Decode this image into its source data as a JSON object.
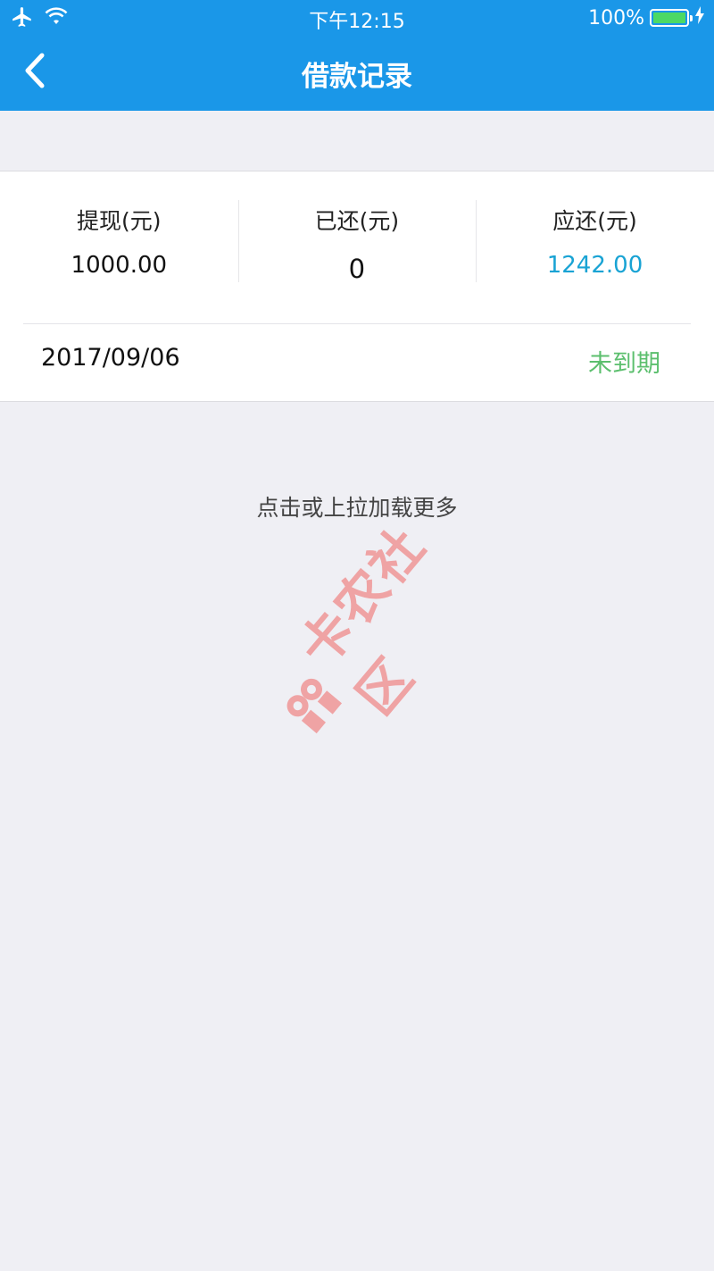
{
  "status_bar": {
    "time": "下午12:15",
    "battery": "100%",
    "icons": [
      "airplane-icon",
      "wifi-icon",
      "battery-icon",
      "charging-icon"
    ]
  },
  "nav": {
    "title": "借款记录",
    "back_icon": "chevron-left-icon"
  },
  "summary": [
    {
      "label": "提现(元)",
      "value": "1000.00"
    },
    {
      "label": "已还(元)",
      "value": "0"
    },
    {
      "label": "应还(元)",
      "value": "1242.00"
    }
  ],
  "record": {
    "date": "2017/09/06",
    "status": "未到期"
  },
  "load_more": "点击或上拉加载更多",
  "watermark": {
    "text": "卡农社区"
  },
  "colors": {
    "header": "#1a97e8",
    "background": "#efeff4",
    "amount_due": "#19a3d4",
    "status_green": "#5cbf6e",
    "watermark": "#f08a8a"
  }
}
